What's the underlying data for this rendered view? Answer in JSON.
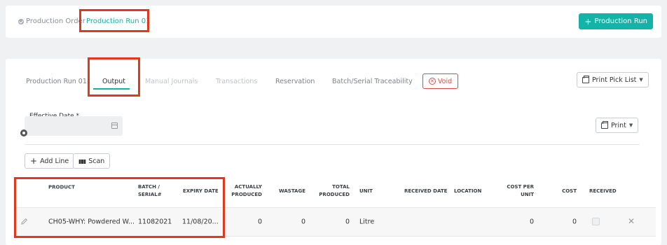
{
  "breadcrumb": {
    "previous": "Production Order",
    "current": "Production Run 01"
  },
  "header": {
    "primary_button": "Production Run",
    "primary_color": "#14b3a7"
  },
  "tabs": [
    {
      "label": "Production Run 01",
      "state": "normal"
    },
    {
      "label": "Output",
      "state": "active"
    },
    {
      "label": "Manual Journals",
      "state": "disabled"
    },
    {
      "label": "Transactions",
      "state": "disabled"
    },
    {
      "label": "Reservation",
      "state": "normal"
    },
    {
      "label": "Batch/Serial Traceability",
      "state": "normal"
    }
  ],
  "void_button": "Void",
  "print_pick_list_button": "Print Pick List",
  "print_button": "Print",
  "effective_date": {
    "label": "Effective Date *",
    "value": ""
  },
  "toolbar": {
    "add_line": "Add Line",
    "scan": "Scan"
  },
  "table": {
    "headers": {
      "product": "PRODUCT",
      "batch_line1": "BATCH /",
      "batch_line2": "SERIAL#",
      "expiry": "EXPIRY DATE",
      "actually_line1": "ACTUALLY",
      "actually_line2": "PRODUCED",
      "wastage": "WASTAGE",
      "total_line1": "TOTAL",
      "total_line2": "PRODUCED",
      "unit": "UNIT",
      "received_date": "RECEIVED DATE",
      "location": "LOCATION",
      "cost_per_line1": "COST PER",
      "cost_per_line2": "UNIT",
      "cost": "COST",
      "received": "RECEIVED"
    },
    "rows": [
      {
        "product": "CH05-WHY: Powdered W...",
        "batch": "11082021",
        "expiry": "11/08/20...",
        "actually_produced": "0",
        "wastage": "0",
        "total_produced": "0",
        "unit": "Litre",
        "received_date": "",
        "location": "",
        "cost_per_unit": "0",
        "cost": "0",
        "received": false
      }
    ]
  },
  "highlight_color": "#e2381d"
}
